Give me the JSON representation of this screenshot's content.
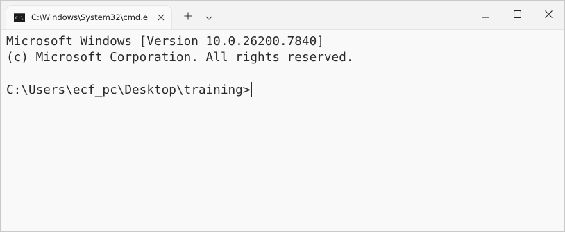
{
  "tab": {
    "title": "C:\\Windows\\System32\\cmd.e",
    "icon": "cmd-icon"
  },
  "titlebar": {
    "new_tab_icon": "plus-icon",
    "dropdown_icon": "chevron-down-icon",
    "minimize_icon": "minimize-icon",
    "maximize_icon": "maximize-icon",
    "close_icon": "close-icon"
  },
  "terminal": {
    "lines": [
      "Microsoft Windows [Version 10.0.26200.7840]",
      "(c) Microsoft Corporation. All rights reserved."
    ],
    "prompt": "C:\\Users\\ecf_pc\\Desktop\\training>"
  },
  "colors": {
    "titlebar_bg": "#f3f3f3",
    "terminal_bg": "#f9f9f9",
    "terminal_fg": "#2a2a2a"
  }
}
